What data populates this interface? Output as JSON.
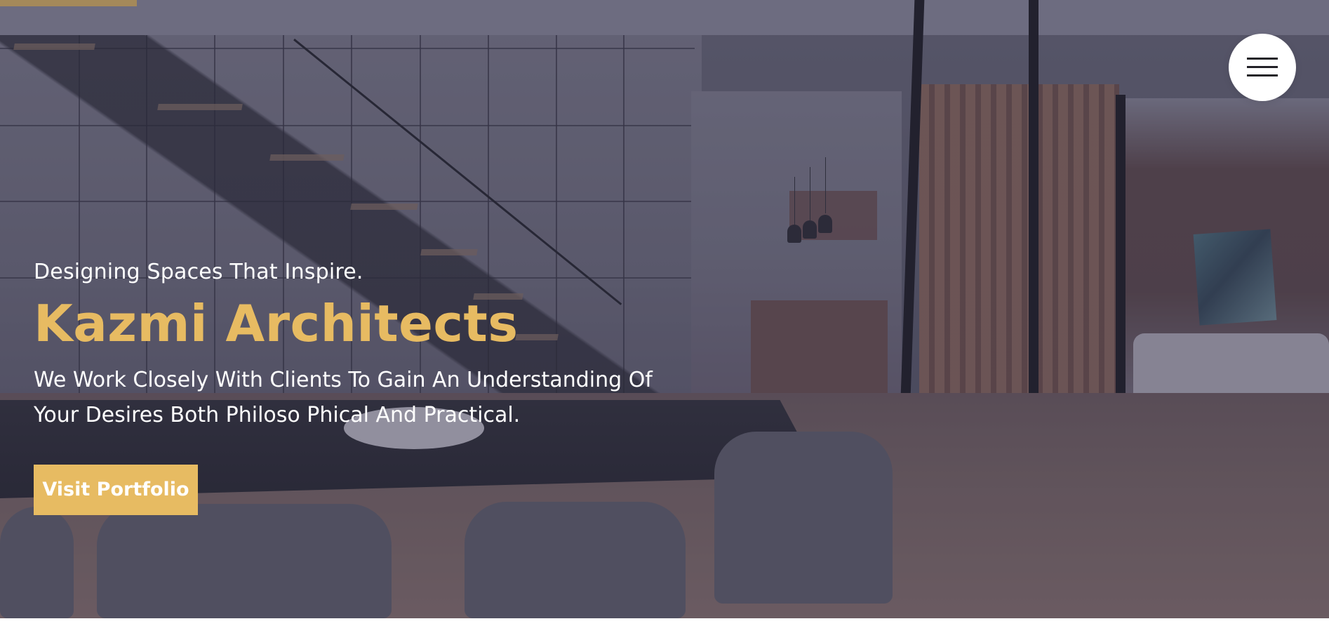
{
  "hero": {
    "eyebrow": "Designing Spaces That Inspire.",
    "title": "Kazmi Architects",
    "description": "We Work Closely With Clients To Gain An Understanding Of Your Desires Both Philoso Phical And Practical.",
    "cta_label": "Visit Portfolio",
    "background_image": "architectural-interior-photo"
  },
  "navigation": {
    "menu_icon": "hamburger-menu-icon"
  },
  "colors": {
    "accent": "#e7bb62",
    "text_light": "#ffffff",
    "overlay": "#38364e",
    "menu_button_bg": "#ffffff"
  }
}
